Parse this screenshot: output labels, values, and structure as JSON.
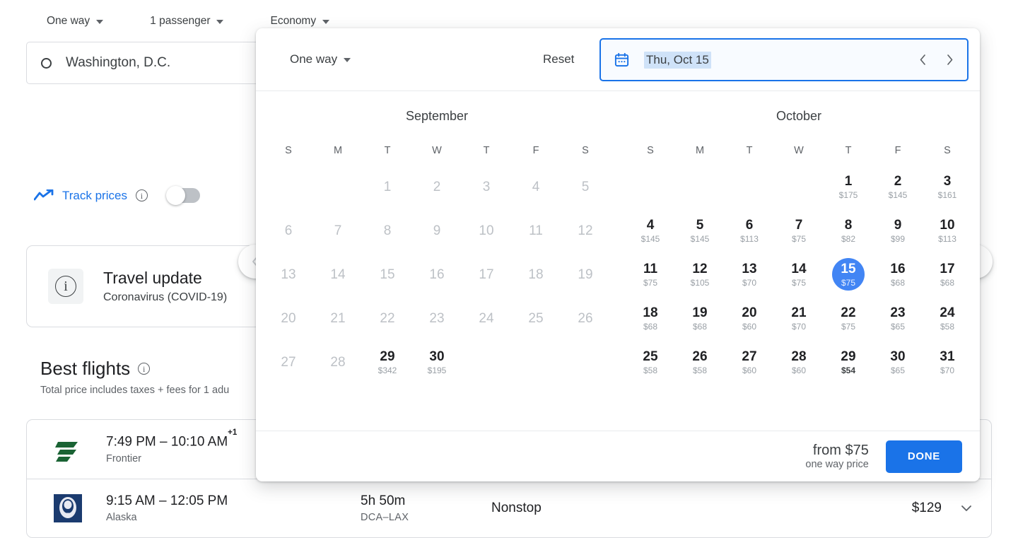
{
  "topbar": {
    "items": [
      {
        "label": "One way",
        "icon": "chevron-down-icon"
      },
      {
        "label": "1 passenger",
        "icon": "chevron-down-icon"
      },
      {
        "label": "Economy",
        "icon": "chevron-down-icon"
      }
    ]
  },
  "search": {
    "origin_value": "Washington, D.C.",
    "origin_icon": "circle-origin-icon"
  },
  "track_prices": {
    "label": "Track prices",
    "icon": "trending-chart-icon",
    "info_icon": "info-icon",
    "toggle_state": "off"
  },
  "travel_update": {
    "icon": "info-icon",
    "title": "Travel update",
    "subtitle": "Coronavirus (COVID-19)"
  },
  "best_flights": {
    "title": "Best flights",
    "info_icon": "info-icon",
    "subtitle": "Total price includes taxes + fees for 1 adu",
    "rows": [
      {
        "airline": "Frontier",
        "logo": "frontier-logo",
        "times": "7:49 PM – 10:10 AM",
        "day_offset": "+1",
        "duration": "",
        "route": "",
        "stops": "",
        "price": ""
      },
      {
        "airline": "Alaska",
        "logo": "alaska-logo",
        "times": "9:15 AM – 12:05 PM",
        "day_offset": "",
        "duration": "5h 50m",
        "route": "DCA–LAX",
        "stops": "Nonstop",
        "price": "$129"
      }
    ]
  },
  "side_nav": {
    "prev_icon": "chevron-left-icon",
    "next_icon": "chevron-right-icon"
  },
  "date_picker": {
    "trip_type": "One way",
    "trip_type_icon": "chevron-down-icon",
    "reset_label": "Reset",
    "calendar_icon": "calendar-icon",
    "date_value": "Thu, Oct 15",
    "prev_date_icon": "chevron-left-icon",
    "next_date_icon": "chevron-right-icon",
    "weekdays": [
      "S",
      "M",
      "T",
      "W",
      "T",
      "F",
      "S"
    ],
    "accent_color": "#1a73e8",
    "selected_color": "#4285f4",
    "footer": {
      "from_price": "from $75",
      "note": "one way price",
      "done_label": "DONE"
    },
    "months": [
      {
        "name": "September",
        "lead_blanks": 2,
        "days": [
          {
            "n": 1,
            "price": null,
            "disabled": true
          },
          {
            "n": 2,
            "price": null,
            "disabled": true
          },
          {
            "n": 3,
            "price": null,
            "disabled": true
          },
          {
            "n": 4,
            "price": null,
            "disabled": true
          },
          {
            "n": 5,
            "price": null,
            "disabled": true
          },
          {
            "n": 6,
            "price": null,
            "disabled": true
          },
          {
            "n": 7,
            "price": null,
            "disabled": true
          },
          {
            "n": 8,
            "price": null,
            "disabled": true
          },
          {
            "n": 9,
            "price": null,
            "disabled": true
          },
          {
            "n": 10,
            "price": null,
            "disabled": true
          },
          {
            "n": 11,
            "price": null,
            "disabled": true
          },
          {
            "n": 12,
            "price": null,
            "disabled": true
          },
          {
            "n": 13,
            "price": null,
            "disabled": true
          },
          {
            "n": 14,
            "price": null,
            "disabled": true
          },
          {
            "n": 15,
            "price": null,
            "disabled": true
          },
          {
            "n": 16,
            "price": null,
            "disabled": true
          },
          {
            "n": 17,
            "price": null,
            "disabled": true
          },
          {
            "n": 18,
            "price": null,
            "disabled": true
          },
          {
            "n": 19,
            "price": null,
            "disabled": true
          },
          {
            "n": 20,
            "price": null,
            "disabled": true
          },
          {
            "n": 21,
            "price": null,
            "disabled": true
          },
          {
            "n": 22,
            "price": null,
            "disabled": true
          },
          {
            "n": 23,
            "price": null,
            "disabled": true
          },
          {
            "n": 24,
            "price": null,
            "disabled": true
          },
          {
            "n": 25,
            "price": null,
            "disabled": true
          },
          {
            "n": 26,
            "price": null,
            "disabled": true
          },
          {
            "n": 27,
            "price": null,
            "disabled": true
          },
          {
            "n": 28,
            "price": null,
            "disabled": true
          },
          {
            "n": 29,
            "price": "$342",
            "disabled": false
          },
          {
            "n": 30,
            "price": "$195",
            "disabled": false
          }
        ]
      },
      {
        "name": "October",
        "lead_blanks": 4,
        "days": [
          {
            "n": 1,
            "price": "$175",
            "disabled": false
          },
          {
            "n": 2,
            "price": "$145",
            "disabled": false
          },
          {
            "n": 3,
            "price": "$161",
            "disabled": false
          },
          {
            "n": 4,
            "price": "$145",
            "disabled": false
          },
          {
            "n": 5,
            "price": "$145",
            "disabled": false
          },
          {
            "n": 6,
            "price": "$113",
            "disabled": false
          },
          {
            "n": 7,
            "price": "$75",
            "disabled": false
          },
          {
            "n": 8,
            "price": "$82",
            "disabled": false
          },
          {
            "n": 9,
            "price": "$99",
            "disabled": false
          },
          {
            "n": 10,
            "price": "$113",
            "disabled": false
          },
          {
            "n": 11,
            "price": "$75",
            "disabled": false
          },
          {
            "n": 12,
            "price": "$105",
            "disabled": false
          },
          {
            "n": 13,
            "price": "$70",
            "disabled": false
          },
          {
            "n": 14,
            "price": "$75",
            "disabled": false
          },
          {
            "n": 15,
            "price": "$75",
            "disabled": false,
            "selected": true
          },
          {
            "n": 16,
            "price": "$68",
            "disabled": false
          },
          {
            "n": 17,
            "price": "$68",
            "disabled": false
          },
          {
            "n": 18,
            "price": "$68",
            "disabled": false
          },
          {
            "n": 19,
            "price": "$68",
            "disabled": false
          },
          {
            "n": 20,
            "price": "$60",
            "disabled": false
          },
          {
            "n": 21,
            "price": "$70",
            "disabled": false
          },
          {
            "n": 22,
            "price": "$75",
            "disabled": false
          },
          {
            "n": 23,
            "price": "$65",
            "disabled": false
          },
          {
            "n": 24,
            "price": "$58",
            "disabled": false
          },
          {
            "n": 25,
            "price": "$58",
            "disabled": false
          },
          {
            "n": 26,
            "price": "$58",
            "disabled": false
          },
          {
            "n": 27,
            "price": "$60",
            "disabled": false
          },
          {
            "n": 28,
            "price": "$60",
            "disabled": false
          },
          {
            "n": 29,
            "price": "$54",
            "disabled": false,
            "cheapest": true
          },
          {
            "n": 30,
            "price": "$65",
            "disabled": false
          },
          {
            "n": 31,
            "price": "$70",
            "disabled": false
          }
        ]
      }
    ]
  }
}
